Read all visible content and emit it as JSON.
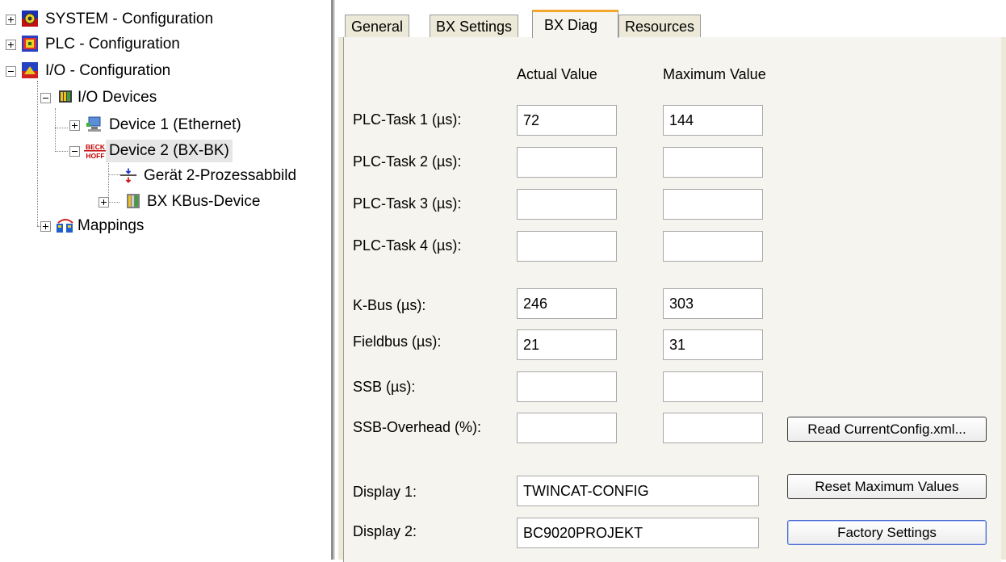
{
  "tree": {
    "system": "SYSTEM - Configuration",
    "plc": "PLC - Configuration",
    "io": "I/O - Configuration",
    "io_devices": "I/O Devices",
    "device1": "Device 1 (Ethernet)",
    "device2": "Device 2 (BX-BK)",
    "device2_logo_top": "BECK",
    "device2_logo_bottom": "HOFF",
    "process_image": "Gerät 2-Prozessabbild",
    "kbus": "BX KBus-Device",
    "mappings": "Mappings"
  },
  "tabs": {
    "general": "General",
    "bx_settings": "BX Settings",
    "bx_diag": "BX Diag",
    "resources": "Resources",
    "active": "BX Diag"
  },
  "diag": {
    "col_actual": "Actual Value",
    "col_max": "Maximum Value",
    "rows": [
      {
        "label": "PLC-Task 1 (µs):",
        "actual": "72",
        "max": "144"
      },
      {
        "label": "PLC-Task 2 (µs):",
        "actual": "",
        "max": ""
      },
      {
        "label": "PLC-Task 3 (µs):",
        "actual": "",
        "max": ""
      },
      {
        "label": "PLC-Task 4 (µs):",
        "actual": "",
        "max": ""
      },
      {
        "label": "K-Bus (µs):",
        "actual": "246",
        "max": "303"
      },
      {
        "label": "Fieldbus (µs):",
        "actual": "21",
        "max": "31"
      },
      {
        "label": "SSB (µs):",
        "actual": "",
        "max": ""
      },
      {
        "label": "SSB-Overhead (%):",
        "actual": "",
        "max": ""
      }
    ],
    "display1_label": "Display 1:",
    "display1_value": "TWINCAT-CONFIG",
    "display2_label": "Display 2:",
    "display2_value": "BC9020PROJEKT"
  },
  "buttons": {
    "read_config": "Read CurrentConfig.xml...",
    "reset_max": "Reset Maximum Values",
    "factory": "Factory Settings"
  }
}
